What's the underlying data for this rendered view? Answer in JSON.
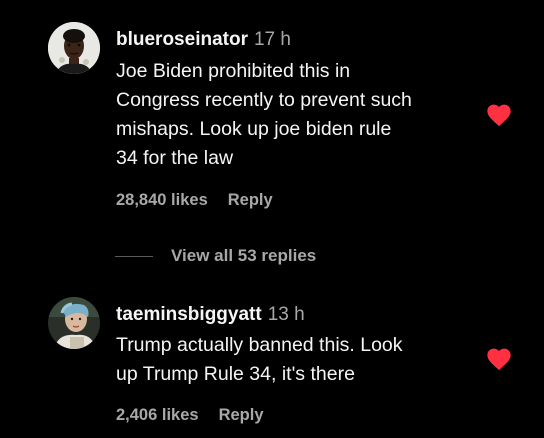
{
  "colors": {
    "background": "#000000",
    "text_primary": "#f5f5f5",
    "text_secondary": "#a8a8a8",
    "heart": "#ff3040"
  },
  "comments": [
    {
      "username": "blueroseinator",
      "time": "17 h",
      "text_lines": [
        "Joe Biden prohibited this in",
        "Congress recently to prevent such",
        "mishaps. Look up joe biden rule",
        "34 for the law"
      ],
      "likes": "28,840 likes",
      "reply_label": "Reply",
      "liked_icon": "heart-filled-icon"
    },
    {
      "username": "taeminsbiggyatt",
      "time": "13 h",
      "text_lines": [
        "Trump actually banned this. Look",
        "up Trump Rule 34, it's there"
      ],
      "likes": "2,406 likes",
      "reply_label": "Reply",
      "liked_icon": "heart-filled-icon"
    }
  ],
  "view_replies": {
    "label": "View all 53 replies"
  }
}
